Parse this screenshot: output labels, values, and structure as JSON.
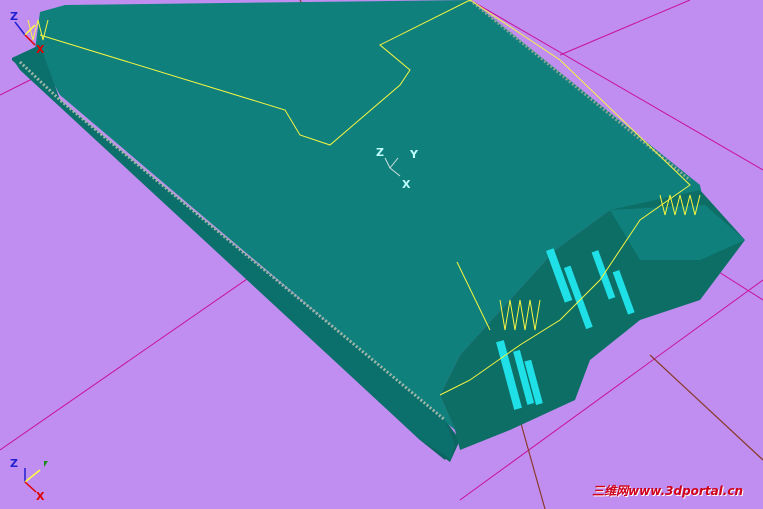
{
  "viewport": {
    "background_color": "#c08ef0",
    "model_colors": {
      "top": "#0f807c",
      "side": "#0a5f5c",
      "rim": "#0b6f6c",
      "highlight": "#1fe0e6"
    },
    "toolpath_color": "#f5f542",
    "grid_color": "#c8109a",
    "axis_colors": {
      "x": "#e00000",
      "y": "#ffff40",
      "z": "#2020d0"
    }
  },
  "axes": {
    "corner": {
      "x": "X",
      "y": "Y",
      "z": "Z"
    },
    "center": {
      "x": "X",
      "y": "Y",
      "z": "Z"
    },
    "origin": {
      "x": "X",
      "z": "Z"
    }
  },
  "watermark": "三维网www.3dportal.cn"
}
